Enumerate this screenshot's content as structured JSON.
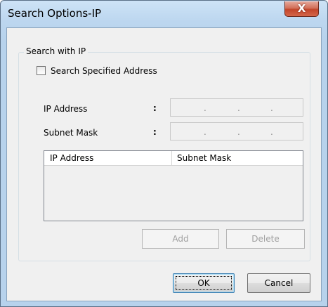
{
  "window": {
    "title": "Search Options-IP",
    "close_label": "X"
  },
  "group": {
    "legend": "Search with IP",
    "checkbox_label": "Search Specified Address",
    "checkbox_checked": false
  },
  "fields": {
    "ip_label": "IP Address",
    "subnet_label": "Subnet Mask",
    "colon": ":",
    "dot": "."
  },
  "list": {
    "columns": [
      "IP Address",
      "Subnet Mask"
    ],
    "rows": []
  },
  "buttons": {
    "add": "Add",
    "delete": "Delete",
    "ok": "OK",
    "cancel": "Cancel"
  },
  "colors": {
    "titlebar": "#bcd6ef",
    "close_button": "#c2462b",
    "dialog_bg": "#f0f0f0"
  }
}
